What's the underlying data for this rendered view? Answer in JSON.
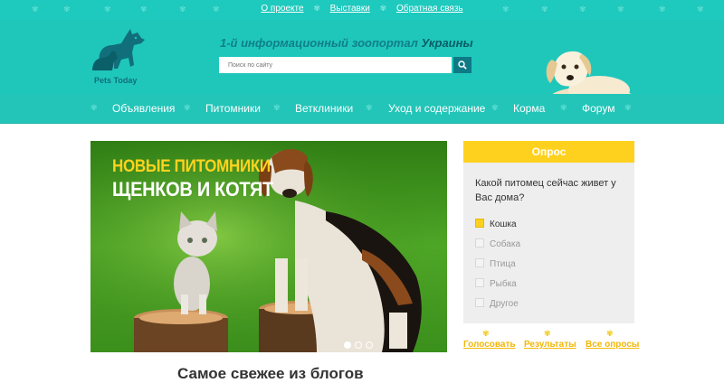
{
  "top_links": [
    "О проекте",
    "Выставки",
    "Обратная связь"
  ],
  "logo_text": "Pets Today",
  "tagline_prefix": "1-й информационный зоопортал",
  "tagline_country": "Украины",
  "search": {
    "placeholder": "Поиск по сайту",
    "value": ""
  },
  "nav": [
    "Объявления",
    "Питомники",
    "Ветклиники",
    "Уход и содержание",
    "Корма",
    "Форум"
  ],
  "slide": {
    "line1": "НОВЫЕ ПИТОМНИКИ",
    "line2": "ЩЕНКОВ И КОТЯТ",
    "dots_total": 3,
    "dot_active": 1
  },
  "poll": {
    "title": "Опрос",
    "question": "Какой питомец сейчас живет у Вас дома?",
    "options": [
      "Кошка",
      "Собака",
      "Птица",
      "Рыбка",
      "Другое"
    ],
    "selected": "Кошка",
    "links": [
      "Голосовать",
      "Результаты",
      "Все опросы"
    ]
  },
  "blog_heading": "Самое свежее из блогов",
  "colors": {
    "teal": "#1fc7bb",
    "dark_teal": "#0e7a85",
    "yellow": "#ffd11f",
    "white": "#ffffff"
  },
  "icons": [
    "paw-icon",
    "search-icon",
    "dog-logo-icon"
  ]
}
